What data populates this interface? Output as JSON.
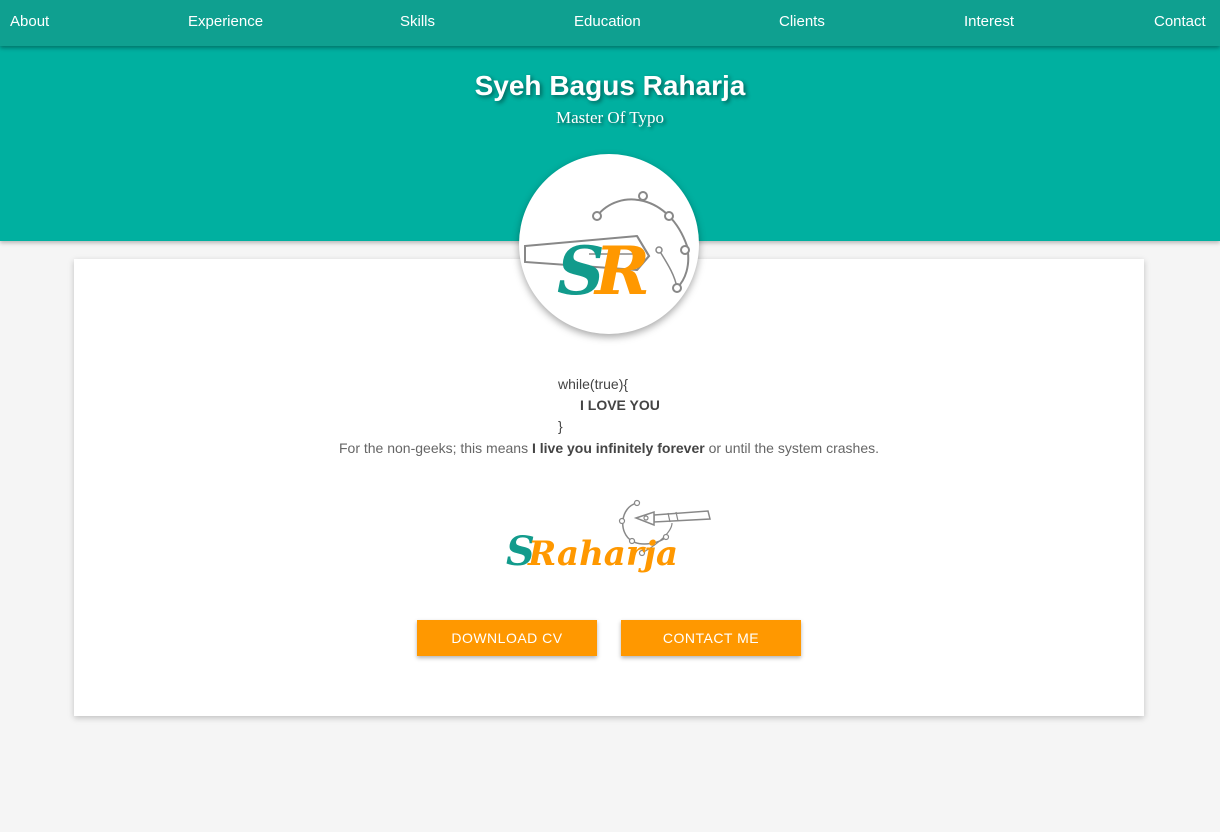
{
  "nav": {
    "items": [
      {
        "label": "About"
      },
      {
        "label": "Experience"
      },
      {
        "label": "Skills"
      },
      {
        "label": "Education"
      },
      {
        "label": "Clients"
      },
      {
        "label": "Interest"
      },
      {
        "label": "Contact"
      }
    ]
  },
  "hero": {
    "name": "Syeh Bagus Raharja",
    "title": "Master Of Typo"
  },
  "avatar": {
    "letter_s": "S",
    "letter_r": "R"
  },
  "intro": {
    "code_open": "while(true){",
    "code_body": "I LOVE YOU",
    "code_close": "}",
    "tagline_start": "For the non-geeks; this means ",
    "tagline_bold": "I live you infinitely forever",
    "tagline_end": " or until the system crashes."
  },
  "signature": {
    "letter_s": "S",
    "rest": "Raharja"
  },
  "buttons": {
    "download_cv": "DOWNLOAD CV",
    "contact_me": "CONTACT ME"
  },
  "colors": {
    "nav_bg": "#0fa090",
    "hero_bg": "#00b0a0",
    "accent_orange": "#ff9800",
    "logo_teal": "#129b8c"
  }
}
